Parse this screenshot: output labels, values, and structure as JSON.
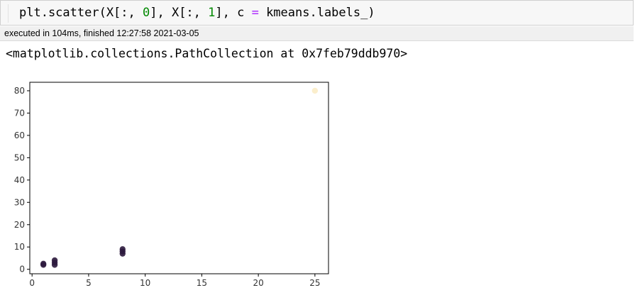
{
  "code_cell": {
    "code_parts": {
      "prefix": "plt.scatter(X[:, ",
      "num0": "0",
      "mid": "], X[:, ",
      "num1": "1",
      "mid2": "], c ",
      "eq": "=",
      "suffix": " kmeans.labels_)"
    }
  },
  "execution": {
    "status_text": "executed in 104ms, finished 12:27:58 2021-03-05"
  },
  "output": {
    "repr_text": "<matplotlib.collections.PathCollection at 0x7feb79ddb970>"
  },
  "chart_data": {
    "type": "scatter",
    "title": "",
    "xlabel": "",
    "ylabel": "",
    "xlim": [
      -0.2,
      26.2
    ],
    "ylim": [
      -2.0,
      83.8
    ],
    "x_ticks": [
      0,
      5,
      10,
      15,
      20,
      25
    ],
    "y_ticks": [
      0,
      10,
      20,
      30,
      40,
      50,
      60,
      70,
      80
    ],
    "grid": false,
    "points": [
      {
        "x": 1,
        "y": 2,
        "label": 0
      },
      {
        "x": 1,
        "y": 2.5,
        "label": 0
      },
      {
        "x": 2,
        "y": 2,
        "label": 0
      },
      {
        "x": 2,
        "y": 3,
        "label": 0
      },
      {
        "x": 2,
        "y": 4,
        "label": 0
      },
      {
        "x": 8,
        "y": 7,
        "label": 0
      },
      {
        "x": 8,
        "y": 8,
        "label": 0
      },
      {
        "x": 8,
        "y": 9,
        "label": 0
      },
      {
        "x": 25,
        "y": 80,
        "label": 1
      }
    ],
    "label_colors": [
      "#2c1a3d",
      "#fbecc6"
    ]
  }
}
